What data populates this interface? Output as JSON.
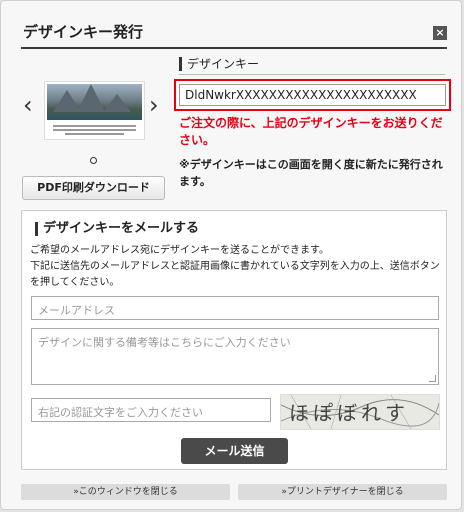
{
  "dialog": {
    "title": "デザインキー発行",
    "close_label": "×"
  },
  "preview": {
    "prev_arrow": "‹",
    "next_arrow": "›",
    "pdf_button": "PDF印刷ダウンロード"
  },
  "design_key": {
    "heading": "デザインキー",
    "value": "DldNwkrXXXXXXXXXXXXXXXXXXXXXX",
    "warning": "ご注文の際に、上記のデザインキーをお送りください。",
    "note": "※デザインキーはこの画面を開く度に新たに発行されます。",
    "highlight_color": "#e60012"
  },
  "mail": {
    "heading": "デザインキーをメールする",
    "description_line1": "ご希望のメールアドレス宛にデザインキーを送ることができます。",
    "description_line2": "下記に送信先のメールアドレスと認証用画像に書かれている文字列を入力の上、送信ボタンを押してください。",
    "email_placeholder": "メールアドレス",
    "memo_placeholder": "デザインに関する備考等はこちらにご入力ください",
    "captcha_placeholder": "右記の認証文字をご入力ください",
    "captcha_text": "ほぽぼれす",
    "send_button": "メール送信"
  },
  "footer": {
    "close_window": "»このウィンドウを閉じる",
    "close_designer": "»プリントデザイナーを閉じる"
  }
}
